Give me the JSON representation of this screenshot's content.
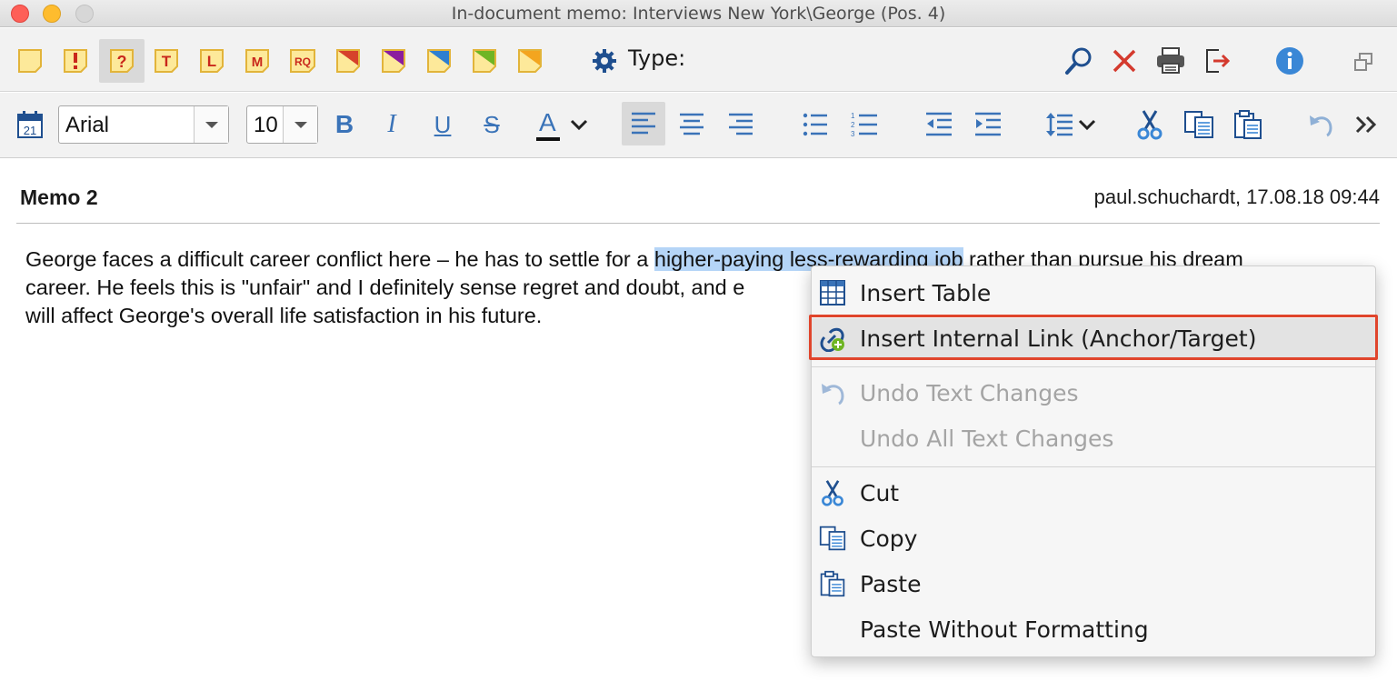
{
  "window": {
    "title": "In-document memo: Interviews New York\\George (Pos. 4)"
  },
  "toolbar1": {
    "memo_types": [
      {
        "name": "memo-yellow",
        "glyph": ""
      },
      {
        "name": "memo-exclaim",
        "glyph": "!"
      },
      {
        "name": "memo-question",
        "glyph": "?"
      },
      {
        "name": "memo-t",
        "glyph": "T"
      },
      {
        "name": "memo-l",
        "glyph": "L"
      },
      {
        "name": "memo-m",
        "glyph": "M"
      },
      {
        "name": "memo-rq",
        "glyph": "RQ"
      }
    ],
    "type_label": "Type:",
    "colors": {
      "memo_fill": "#fde99a",
      "memo_border": "#e2b43a",
      "memo_glyph": "#c9281c",
      "search": "#1f4f8f",
      "delete": "#d43a2e",
      "info": "#3a87d6"
    }
  },
  "toolbar2": {
    "font_family": "Arial",
    "font_size": "10",
    "calendar_day": "21",
    "bold": "B",
    "italic": "I",
    "underline": "U",
    "strike": "S",
    "font_color": "A"
  },
  "memo": {
    "title": "Memo 2",
    "meta": "paul.schuchardt, 17.08.18 09:44",
    "line1_before": "George faces a difficult career conflict here – he has to settle for a ",
    "line1_highlight": "higher-paying less-rewarding job",
    "line1_after": " rather than pursue his dream",
    "line2": "career. He feels this is \"unfair\" and I definitely sense regret and doubt, and e",
    "line3": "will affect George's overall life satisfaction in his future."
  },
  "context_menu": {
    "items": [
      {
        "label": "Insert Table",
        "icon": "table-icon",
        "enabled": true
      },
      {
        "label": "Insert Internal Link (Anchor/Target)",
        "icon": "link-add-icon",
        "enabled": true,
        "highlighted": true
      },
      {
        "label": "Undo Text Changes",
        "icon": "undo-icon",
        "enabled": false
      },
      {
        "label": "Undo All Text Changes",
        "icon": "",
        "enabled": false
      },
      {
        "label": "Cut",
        "icon": "scissors-icon",
        "enabled": true
      },
      {
        "label": "Copy",
        "icon": "copy-icon",
        "enabled": true
      },
      {
        "label": "Paste",
        "icon": "paste-icon",
        "enabled": true
      },
      {
        "label": "Paste Without Formatting",
        "icon": "",
        "enabled": true
      }
    ],
    "highlight_color": "#e0452c"
  }
}
